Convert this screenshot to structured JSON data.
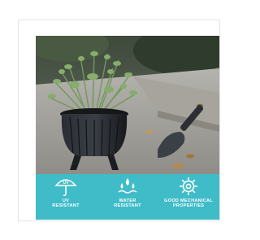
{
  "features": [
    {
      "icon": "umbrella-uv-icon",
      "badge": "UV",
      "label": "UV\nRESISTANT"
    },
    {
      "icon": "water-drops-icon",
      "label": "WATER\nRESISTANT"
    },
    {
      "icon": "gear-icon",
      "label": "GOOD MECHANICAL\nPROPERTIES"
    }
  ],
  "colors": {
    "banner": "#3fbcc8",
    "text": "#ffffff",
    "pot": "#1f2228",
    "plant": "#6f9a5a"
  }
}
